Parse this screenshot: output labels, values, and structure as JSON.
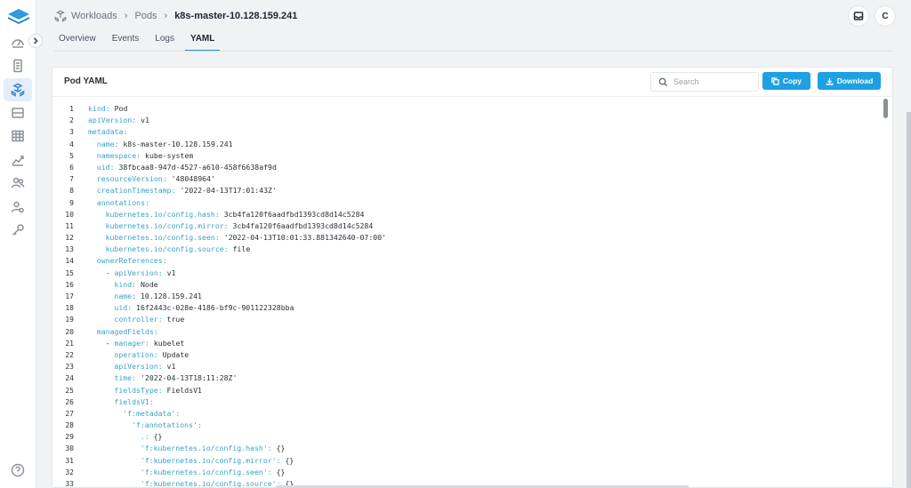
{
  "breadcrumb": {
    "items": [
      "Workloads",
      "Pods",
      "k8s-master-10.128.159.241"
    ]
  },
  "header": {
    "avatar_initial": "C"
  },
  "tabs": [
    {
      "label": "Overview"
    },
    {
      "label": "Events"
    },
    {
      "label": "Logs"
    },
    {
      "label": "YAML"
    }
  ],
  "active_tab": "YAML",
  "card": {
    "title": "Pod YAML",
    "search_placeholder": "Search",
    "copy_label": "Copy",
    "download_label": "Download"
  },
  "colors": {
    "accent": "#1da1e2",
    "key": "#3aa3c9",
    "tab_underline": "#2f8ed6"
  },
  "sidebar_icons": [
    "dashboard-icon",
    "cluster-icon",
    "workloads-icon",
    "storage-icon",
    "table-icon",
    "monitoring-icon",
    "users-icon",
    "user-settings-icon",
    "key-icon",
    "help-icon"
  ],
  "yaml": [
    {
      "n": "1",
      "i": 0,
      "k": "kind",
      "v": " Pod"
    },
    {
      "n": "2",
      "i": 0,
      "k": "apiVersion",
      "v": " v1"
    },
    {
      "n": "3",
      "i": 0,
      "k": "metadata",
      "v": ""
    },
    {
      "n": "4",
      "i": 2,
      "k": "name",
      "v": " k8s-master-10.128.159.241"
    },
    {
      "n": "5",
      "i": 2,
      "k": "namespace",
      "v": " kube-system"
    },
    {
      "n": "6",
      "i": 2,
      "k": "uid",
      "v": " 38fbcaa8-947d-4527-a610-458f6638af9d"
    },
    {
      "n": "7",
      "i": 2,
      "k": "resourceVersion",
      "v": " '48048964'"
    },
    {
      "n": "8",
      "i": 2,
      "k": "creationTimestamp",
      "v": " '2022-04-13T17:01:43Z'"
    },
    {
      "n": "9",
      "i": 2,
      "k": "annotations",
      "v": ""
    },
    {
      "n": "10",
      "i": 4,
      "k": "kubernetes.io/config.hash",
      "v": " 3cb4fa120f6aadfbd1393cd8d14c5284"
    },
    {
      "n": "11",
      "i": 4,
      "k": "kubernetes.io/config.mirror",
      "v": " 3cb4fa120f6aadfbd1393cd8d14c5284"
    },
    {
      "n": "12",
      "i": 4,
      "k": "kubernetes.io/config.seen",
      "v": " '2022-04-13T10:01:33.881342640-07:00'"
    },
    {
      "n": "13",
      "i": 4,
      "k": "kubernetes.io/config.source",
      "v": " file"
    },
    {
      "n": "14",
      "i": 2,
      "k": "ownerReferences",
      "v": ""
    },
    {
      "n": "15",
      "i": 4,
      "p": "- ",
      "k": "apiVersion",
      "v": " v1"
    },
    {
      "n": "16",
      "i": 6,
      "k": "kind",
      "v": " Node"
    },
    {
      "n": "17",
      "i": 6,
      "k": "name",
      "v": " 10.128.159.241"
    },
    {
      "n": "18",
      "i": 6,
      "k": "uid",
      "v": " 16f2443c-028e-4186-bf9c-901122328bba"
    },
    {
      "n": "19",
      "i": 6,
      "k": "controller",
      "v": " true"
    },
    {
      "n": "20",
      "i": 2,
      "k": "managedFields",
      "v": ""
    },
    {
      "n": "21",
      "i": 4,
      "p": "- ",
      "k": "manager",
      "v": " kubelet"
    },
    {
      "n": "22",
      "i": 6,
      "k": "operation",
      "v": " Update"
    },
    {
      "n": "23",
      "i": 6,
      "k": "apiVersion",
      "v": " v1"
    },
    {
      "n": "24",
      "i": 6,
      "k": "time",
      "v": " '2022-04-13T18:11:28Z'"
    },
    {
      "n": "25",
      "i": 6,
      "k": "fieldsType",
      "v": " FieldsV1"
    },
    {
      "n": "26",
      "i": 6,
      "k": "fieldsV1",
      "v": ""
    },
    {
      "n": "27",
      "i": 8,
      "k": "'f:metadata'",
      "v": ""
    },
    {
      "n": "28",
      "i": 10,
      "k": "'f:annotations'",
      "v": ""
    },
    {
      "n": "29",
      "i": 12,
      "k": ".",
      "v": " {}"
    },
    {
      "n": "30",
      "i": 12,
      "k": "'f:kubernetes.io/config.hash'",
      "v": " {}"
    },
    {
      "n": "31",
      "i": 12,
      "k": "'f:kubernetes.io/config.mirror'",
      "v": " {}"
    },
    {
      "n": "32",
      "i": 12,
      "k": "'f:kubernetes.io/config.seen'",
      "v": " {}"
    },
    {
      "n": "33",
      "i": 12,
      "k": "'f:kubernetes.io/config.source'",
      "v": " {}"
    }
  ]
}
